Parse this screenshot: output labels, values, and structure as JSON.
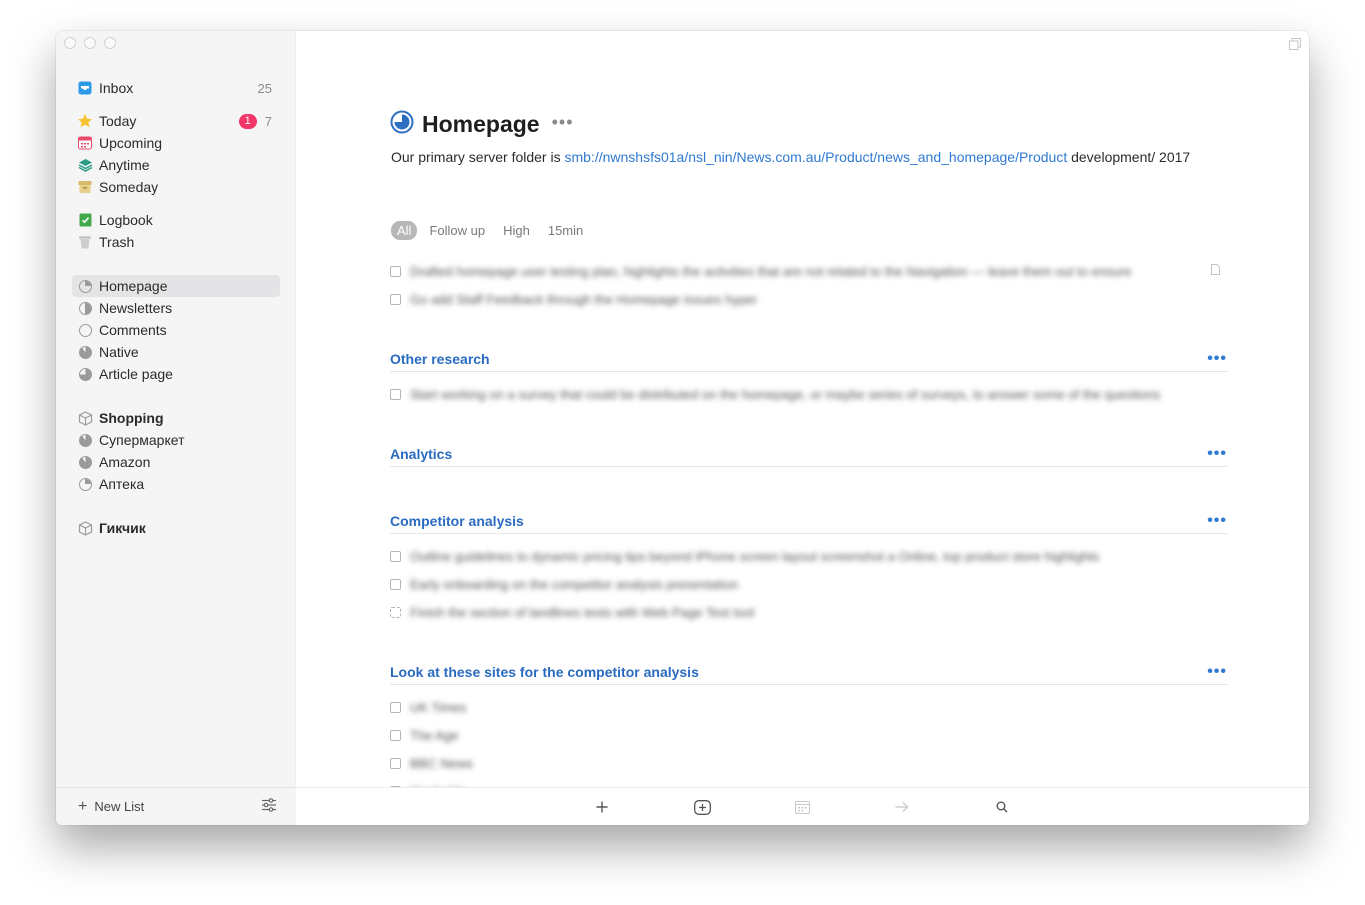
{
  "sidebar": {
    "inbox": {
      "label": "Inbox",
      "count": "25"
    },
    "today": {
      "label": "Today",
      "badge": "1",
      "count": "7"
    },
    "upcoming": {
      "label": "Upcoming"
    },
    "anytime": {
      "label": "Anytime"
    },
    "someday": {
      "label": "Someday"
    },
    "logbook": {
      "label": "Logbook"
    },
    "trash": {
      "label": "Trash"
    },
    "projects": [
      {
        "label": "Homepage"
      },
      {
        "label": "Newsletters"
      },
      {
        "label": "Comments"
      },
      {
        "label": "Native"
      },
      {
        "label": "Article page"
      }
    ],
    "area_shopping": {
      "label": "Shopping"
    },
    "shopping_items": [
      {
        "label": "Супермаркет"
      },
      {
        "label": "Amazon"
      },
      {
        "label": "Аптека"
      }
    ],
    "area_geek": {
      "label": "Гикчик"
    },
    "new_list": "New List"
  },
  "project": {
    "title": "Homepage",
    "more": "•••",
    "notes_prefix": "Our primary server folder is ",
    "notes_link": "smb://nwnshsfs01a/nsl_nin/News.com.au/Product/news_and_homepage/Product",
    "notes_suffix": " development/ 2017"
  },
  "tags": [
    "All",
    "Follow up",
    "High",
    "15min"
  ],
  "todos_top": [
    "Drafted homepage user testing plan, highlights the activities that are not related to the Navigation — leave them out to ensure",
    "Go add Staff Feedback through the Homepage Issues hyper"
  ],
  "headings": {
    "other_research": {
      "title": "Other research",
      "more": "•••",
      "todos": [
        "Start working on a survey that could be distributed on the homepage, or maybe series of surveys, to answer some of the questions"
      ]
    },
    "analytics": {
      "title": "Analytics",
      "more": "•••"
    },
    "competitor": {
      "title": "Competitor analysis",
      "more": "•••",
      "todos": [
        "Outline guidelines to dynamic pricing tips beyond iPhone screen layout screenshot a Online, top product store highlights",
        "Early onboarding on the competitor analysis presentation",
        "Finish the section of landlines tests with Web Page Test tool"
      ]
    },
    "sites": {
      "title": "Look at these sites for the competitor analysis",
      "more": "•••",
      "todos": [
        "UK Times",
        "The Age",
        "BBC News",
        "Mashable"
      ]
    }
  },
  "colors": {
    "accent": "#2f7ad3",
    "badge": "#f2366a",
    "heading": "#2a6bc0"
  }
}
